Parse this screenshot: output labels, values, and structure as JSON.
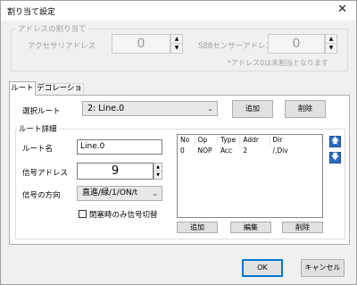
{
  "window": {
    "title": "割り当て設定",
    "close_glyph": "✕"
  },
  "address_group": {
    "title": "アドレスの割り当て",
    "accessory_label": "アクセサリアドレス",
    "accessory_value": "0",
    "s88_label": "S88センサーアドレス",
    "s88_value": "0",
    "note": "*アドレス0は未割当となります"
  },
  "tabs": [
    {
      "label": "ルート"
    },
    {
      "label": "デコレーション"
    }
  ],
  "route": {
    "select_label": "選択ルート",
    "selected_route": "2: Line.0",
    "add_label": "追加",
    "delete_label": "削除"
  },
  "route_detail": {
    "title": "ルート詳細",
    "name_label": "ルート名",
    "name_value": "Line.0",
    "signal_address_label": "信号アドレス",
    "signal_address_value": "9",
    "signal_direction_label": "信号の方向",
    "signal_direction_value": "直進/緑/1/ON/t",
    "checkbox_label": "閉塞時のみ信号切替",
    "checkbox_checked": false,
    "table": {
      "columns": [
        "No",
        "Op",
        "Type",
        "Addr",
        "Dir"
      ],
      "rows": [
        [
          "0",
          "NOP",
          "Acc",
          "2",
          "/,Div"
        ]
      ]
    },
    "add_label": "追加",
    "edit_label": "編集",
    "delete_label": "削除",
    "up_glyph": "🡅",
    "down_glyph": "🡇"
  },
  "footer": {
    "ok_label": "OK",
    "cancel_label": "キャンセル"
  },
  "colors": {
    "accent": "#0078d7",
    "arrow_button": "#2b6cc4"
  }
}
